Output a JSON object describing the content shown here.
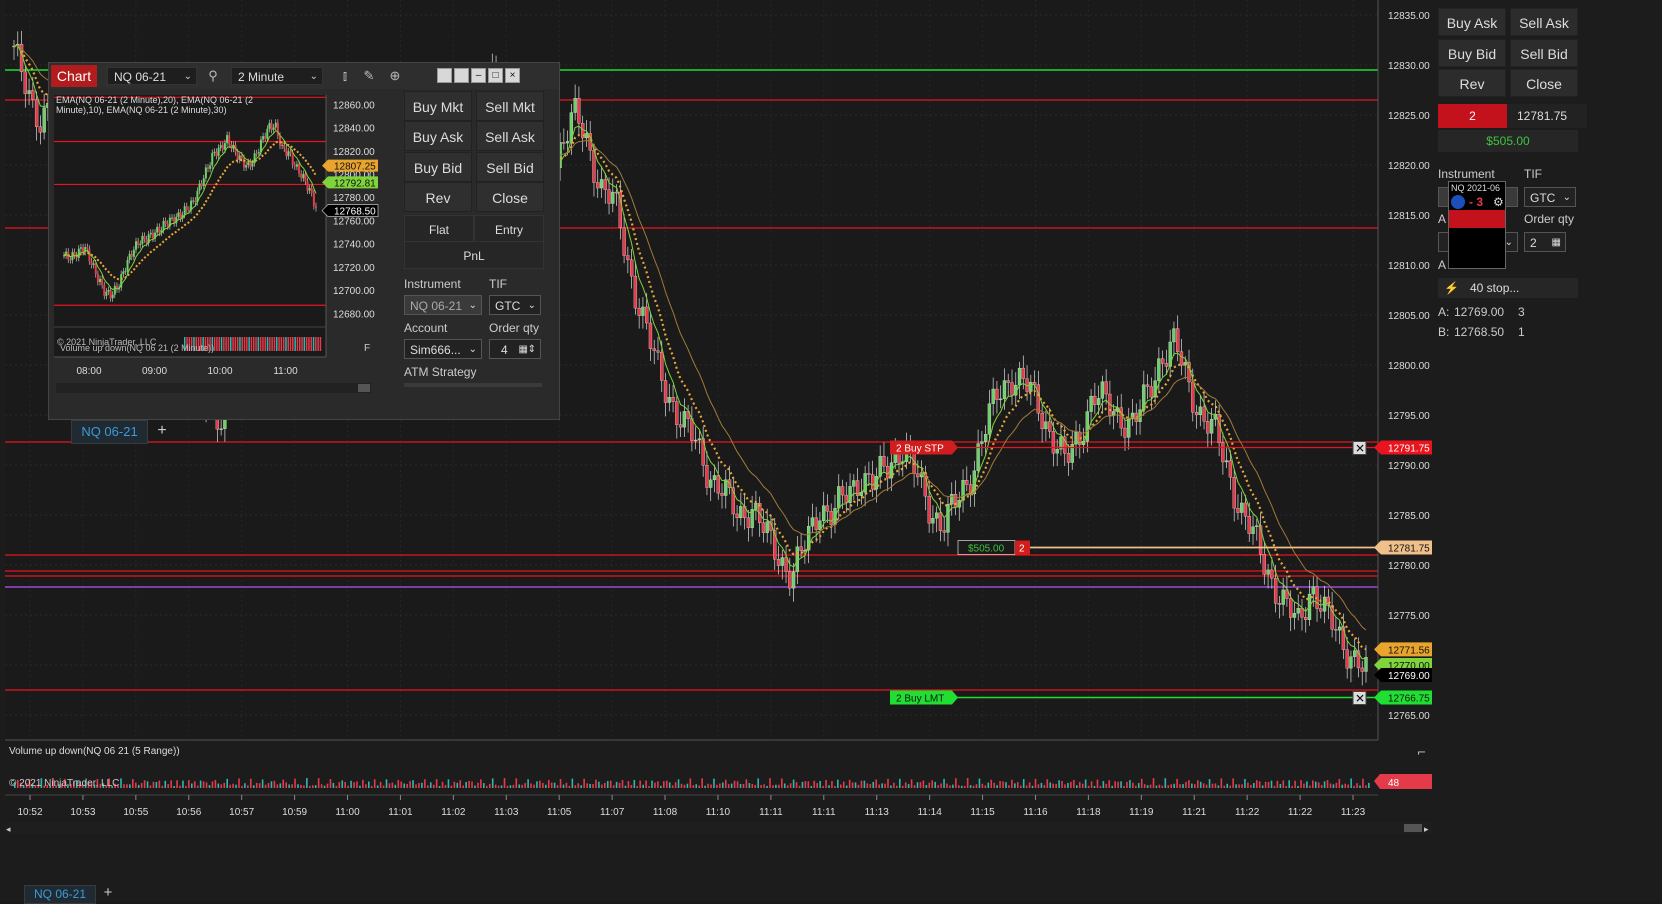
{
  "main_chart": {
    "instrument_tab": "NQ 06-21",
    "price_axis": {
      "ticks": [
        "12835.00",
        "12830.00",
        "12825.00",
        "12820.00",
        "12815.00",
        "12810.00",
        "12805.00",
        "12800.00",
        "12795.00",
        "12790.00",
        "12785.00",
        "12780.00",
        "12775.00",
        "12770.00",
        "12765.00"
      ],
      "range": [
        12762.5,
        12836.5
      ]
    },
    "time_axis": {
      "ticks": [
        "10:52",
        "10:53",
        "10:55",
        "10:56",
        "10:57",
        "10:59",
        "11:00",
        "11:01",
        "11:02",
        "11:03",
        "11:05",
        "11:07",
        "11:08",
        "11:10",
        "11:11",
        "11:11",
        "11:13",
        "11:14",
        "11:15",
        "11:16",
        "11:18",
        "11:19",
        "11:21",
        "11:22",
        "11:22",
        "11:23"
      ]
    },
    "horizontal_levels": {
      "green": 12829.5,
      "red": [
        12826.5,
        12813.7,
        12792.3,
        12781.0,
        12779.4,
        12778.9
      ],
      "purple": 12777.8,
      "red_low": 12767.5
    },
    "price_series": [
      12831,
      12828,
      12824,
      12826,
      12829,
      12822,
      12818,
      12820,
      12814,
      12812,
      12808,
      12805,
      12800,
      12798,
      12796,
      12795,
      12797,
      12801,
      12806,
      12812,
      12816,
      12820,
      12824,
      12822,
      12818,
      12815,
      12812,
      12808,
      12806,
      12804,
      12810,
      12815,
      12818,
      12822,
      12826,
      12829,
      12826,
      12822,
      12820,
      12818,
      12822,
      12825,
      12822,
      12818,
      12816,
      12810,
      12805,
      12800,
      12797,
      12794,
      12792,
      12789,
      12787,
      12785,
      12786,
      12783,
      12781,
      12779,
      12782,
      12786,
      12785,
      12787,
      12789,
      12788,
      12790,
      12792,
      12789,
      12786,
      12784,
      12786,
      12789,
      12793,
      12797,
      12799,
      12798,
      12796,
      12793,
      12790,
      12793,
      12797,
      12796,
      12795,
      12794,
      12797,
      12801,
      12802,
      12798,
      12795,
      12793,
      12789,
      12785,
      12782,
      12779,
      12776,
      12774,
      12778,
      12775,
      12773,
      12771,
      12769
    ],
    "orders": {
      "buy_stp": {
        "label": "2  Buy STP",
        "price_tag": "12791.75",
        "value": 12791.75
      },
      "position": {
        "pnl": "$505.00",
        "qty": "2",
        "price_tag": "12781.75",
        "value": 12781.75
      },
      "buy_lmt": {
        "label": "2  Buy LMT",
        "price_tag": "12766.75",
        "value": 12766.75
      }
    },
    "price_tags": [
      {
        "text": "12771.56",
        "value": 12771.56,
        "color": "#e8a42c"
      },
      {
        "text": "12770.00",
        "value": 12770.0,
        "color": "#7fd43b"
      },
      {
        "text": "12769.00",
        "value": 12769.0,
        "color": "#000000"
      }
    ],
    "indicator_label": "Volume up down(NQ 06 21 (5 Range))",
    "copyright": "© 2021 NinjaTrader, LLC",
    "volume_tag": "48"
  },
  "mini_window": {
    "chart_tab": "Chart",
    "instrument": "NQ 06-21",
    "interval": "2 Minute",
    "legend": "EMA(NQ 06-21 (2 Minute),20), EMA(NQ 06-21 (2 Minute),10), EMA(NQ 06-21 (2 Minute),30)",
    "price_ticks": [
      "12860.00",
      "12840.00",
      "12820.00",
      "12800.00",
      "12780.00",
      "12760.00",
      "12740.00",
      "12720.00",
      "12700.00",
      "12680.00"
    ],
    "price_range": [
      12670,
      12868
    ],
    "price_tags": [
      {
        "text": "12807.25",
        "value": 12807.25,
        "color": "#e8a42c"
      },
      {
        "text": "12792.81",
        "value": 12792.81,
        "color": "#7fd43b"
      },
      {
        "text": "12768.50",
        "value": 12768.5,
        "color": "#000000"
      }
    ],
    "time_ticks": [
      "08:00",
      "09:00",
      "10:00",
      "11:00"
    ],
    "red_levels": [
      12866,
      12828,
      12791,
      12687
    ],
    "price_series": [
      12730,
      12728,
      12732,
      12738,
      12724,
      12710,
      12698,
      12696,
      12704,
      12720,
      12733,
      12742,
      12744,
      12748,
      12752,
      12758,
      12761,
      12764,
      12770,
      12776,
      12790,
      12804,
      12818,
      12822,
      12830,
      12820,
      12812,
      12806,
      12814,
      12828,
      12840,
      12842,
      12822,
      12818,
      12806,
      12798,
      12787,
      12771
    ],
    "copyright": "© 2021 NinjaTrader, LLC",
    "volume_label": "Volume up down(NQ 06 21 (2 Minute))",
    "tab": "NQ 06-21",
    "f_marker": "F"
  },
  "chart_trader": {
    "buy_mkt": "Buy Mkt",
    "sell_mkt": "Sell Mkt",
    "buy_ask": "Buy Ask",
    "sell_ask": "Sell Ask",
    "buy_bid": "Buy Bid",
    "sell_bid": "Sell Bid",
    "rev": "Rev",
    "close": "Close",
    "flat": "Flat",
    "entry": "Entry",
    "pnl": "PnL",
    "instrument_label": "Instrument",
    "instrument_value": "NQ 06-21",
    "tif_label": "TIF",
    "tif_value": "GTC",
    "account_label": "Account",
    "account_value": "Sim666...",
    "order_qty_label": "Order qty",
    "order_qty_value": "4",
    "atm_label": "ATM Strategy"
  },
  "right_panel": {
    "buy_ask": "Buy Ask",
    "sell_ask": "Sell Ask",
    "buy_bid": "Buy Bid",
    "sell_bid": "Sell Bid",
    "rev": "Rev",
    "close": "Close",
    "position_qty": "2",
    "position_price": "12781.75",
    "pnl": "$505.00",
    "instrument_label": "Instrument",
    "tif_label": "TIF",
    "tif_value": "GTC",
    "account_partial": "A",
    "order_qty_label": "Order qty",
    "order_qty_value": "2",
    "atm_partial": "A",
    "atm_value": "40 stop...",
    "ask_label": "A:",
    "ask_price": "12769.00",
    "ask_size": "3",
    "bid_label": "B:",
    "bid_price": "12768.50",
    "bid_size": "1",
    "popup": {
      "instrument": "NQ 2021-06",
      "qty": "- 3"
    }
  },
  "colors": {
    "up_candle": "#6dd16a",
    "down_candle": "#e33b4a",
    "level_red": "#e8141e",
    "level_green": "#19e02e",
    "ema_dotted": "#e5a63a",
    "buy_green": "#1fe032"
  }
}
